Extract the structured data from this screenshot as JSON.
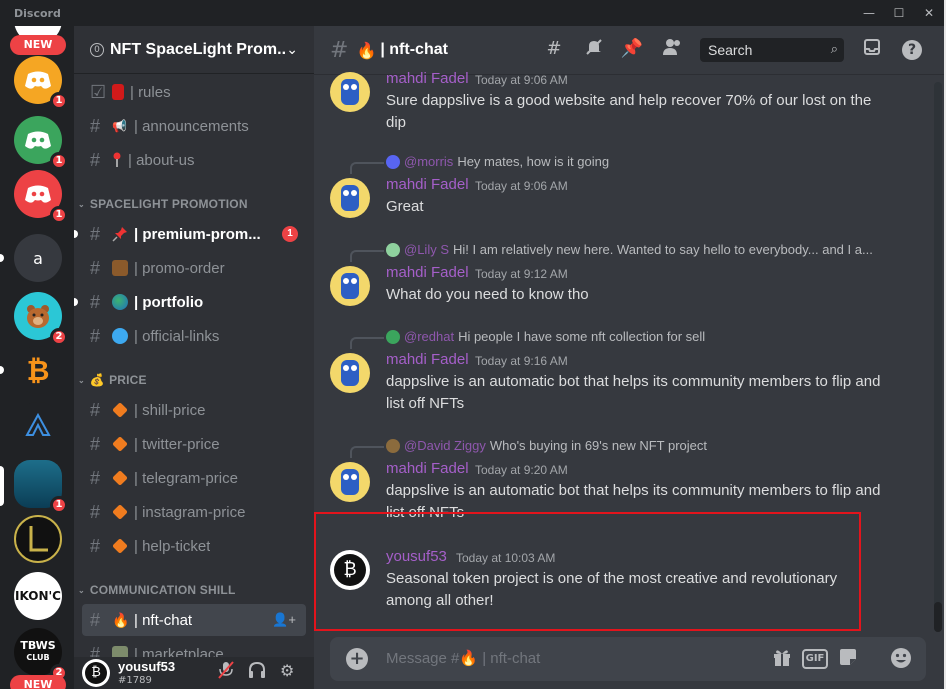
{
  "window": {
    "app_name": "Discord",
    "minimize": "—",
    "maximize": "☐",
    "close": "✕"
  },
  "server_rail": {
    "new_label": "NEW",
    "servers": [
      {
        "name": "discord-server-1",
        "badge": "1"
      },
      {
        "name": "discord-server-2",
        "badge": "1"
      },
      {
        "name": "discord-server-3",
        "badge": "1"
      },
      {
        "name": "a",
        "badge": ""
      },
      {
        "name": "bear-server",
        "badge": "2"
      },
      {
        "name": "bitcoin-server",
        "badge": ""
      },
      {
        "name": "alpin-server",
        "badge": ""
      },
      {
        "name": "ocean-server",
        "badge": "1"
      },
      {
        "name": "l-server",
        "badge": ""
      },
      {
        "name": "IKONIC",
        "badge": ""
      },
      {
        "name": "TBWS CLUB",
        "badge": "2"
      }
    ],
    "letter_a": "a",
    "ikonic": "IKON'C",
    "tbws_1": "TBWS",
    "tbws_2": "CLUB"
  },
  "guild": {
    "name": "NFT SpaceLight Prom...",
    "icon": "0"
  },
  "channels": {
    "top": [
      {
        "label": "| rules",
        "icon": "rules-book"
      },
      {
        "label": "| announcements",
        "icon": "megaphone"
      },
      {
        "label": "| about-us",
        "icon": "pin"
      }
    ],
    "cat_spacelight": "SPACELIGHT PROMOTION",
    "spacelight": [
      {
        "label": "| premium-prom...",
        "badge": "1"
      },
      {
        "label": "| promo-order"
      },
      {
        "label": "| portfolio"
      },
      {
        "label": "| official-links"
      }
    ],
    "cat_price": "PRICE",
    "price": [
      {
        "label": "| shill-price"
      },
      {
        "label": "| twitter-price"
      },
      {
        "label": "| telegram-price"
      },
      {
        "label": "| instagram-price"
      },
      {
        "label": "| help-ticket"
      }
    ],
    "cat_comm": "COMMUNICATION SHILL",
    "comm": [
      {
        "label": "| nft-chat"
      },
      {
        "label": "| marketplace"
      }
    ]
  },
  "user_panel": {
    "username": "yousuf53",
    "tag": "#1789"
  },
  "chat_header": {
    "channel_name": "| nft-chat",
    "search_placeholder": "Search"
  },
  "messages": [
    {
      "author": "mahdi Fadel",
      "time": "Today at 9:06 AM",
      "text": "Sure dappslive is a good website and help recover 70% of our lost on the dip"
    },
    {
      "reply_name": "@morris",
      "reply_text": "Hey mates, how  is it going",
      "author": "mahdi Fadel",
      "time": "Today at 9:06 AM",
      "text": "Great"
    },
    {
      "reply_name": "@Lily S",
      "reply_text": "Hi! I am relatively new here. Wanted to say hello to everybody... and I a...",
      "author": "mahdi Fadel",
      "time": "Today at 9:12 AM",
      "text": "What do you need to know tho"
    },
    {
      "reply_name": "@redhat",
      "reply_text": "Hi people  I have some nft collection  for sell",
      "author": "mahdi Fadel",
      "time": "Today at 9:16 AM",
      "text": "dappslive is an automatic bot that helps its community members to flip and list off NFTs"
    },
    {
      "reply_name": "@David Ziggy",
      "reply_text": "Who's buying in 69's new NFT project",
      "author": "mahdi Fadel",
      "time": "Today at 9:20 AM",
      "text": "dappslive is an automatic bot that helps its community members to flip and list off NFTs"
    },
    {
      "author": "yousuf53",
      "time": "Today at 10:03 AM",
      "text": "Seasonal token project is one of the most creative and revolutionary among all other!"
    }
  ],
  "composer": {
    "placeholder_prefix": "Message #",
    "placeholder_suffix": " | nft-chat",
    "gif_label": "GIF"
  },
  "colors": {
    "accent_red": "#ed4245",
    "author_purple": "#a55fc9",
    "highlight_red": "#e3141c"
  }
}
